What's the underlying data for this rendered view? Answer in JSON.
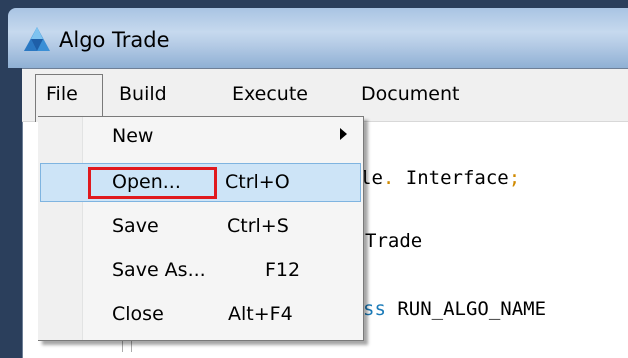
{
  "window": {
    "title": "Algo Trade",
    "icon": "algo-trade-app-icon"
  },
  "menubar": {
    "items": [
      {
        "label": "File"
      },
      {
        "label": "Build"
      },
      {
        "label": "Execute"
      },
      {
        "label": "Document"
      }
    ]
  },
  "file_menu": {
    "items": [
      {
        "label": "New",
        "shortcut": "",
        "submenu": true,
        "icon": "submenu-arrow-icon"
      },
      {
        "label": "Open...",
        "shortcut": "Ctrl+O",
        "highlighted": true
      },
      {
        "label": "Save",
        "shortcut": "Ctrl+S"
      },
      {
        "label": "Save As...",
        "shortcut": "F12"
      },
      {
        "label": "Close",
        "shortcut": "Alt+F4"
      }
    ]
  },
  "editor": {
    "line1_text": "le",
    "line1_dot": ".",
    "line1_ident": "Interface",
    "line1_semi": ";",
    "line2_text": "Trade",
    "line3_kw": "ss",
    "line3_text": "RUN_ALGO_NAME"
  },
  "colors": {
    "highlight": "#cde4f7",
    "annotation_box": "#e0191e",
    "keyword": "#1a7ab8",
    "punctuation": "#d08a00"
  }
}
